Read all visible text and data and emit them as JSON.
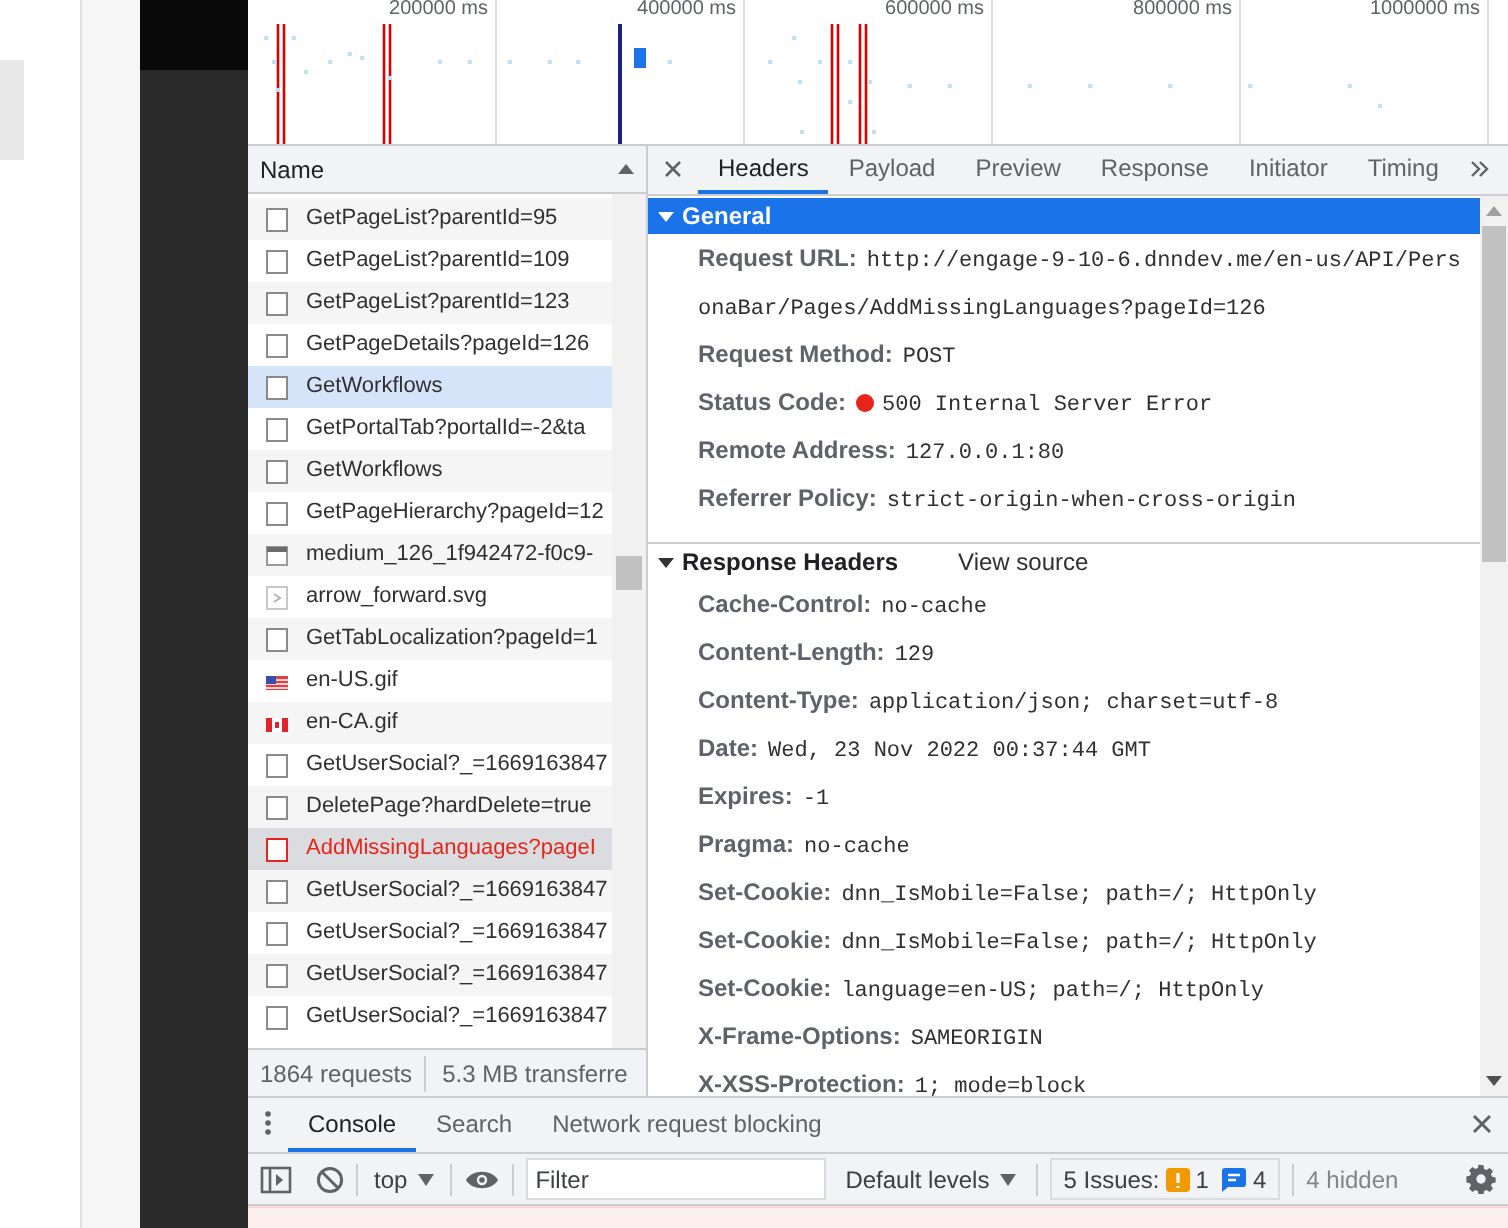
{
  "timeline": {
    "ticks": [
      "200000 ms",
      "400000 ms",
      "600000 ms",
      "800000 ms",
      "1000000 ms"
    ]
  },
  "requests": {
    "column": "Name",
    "rows": [
      {
        "name": "GetPageList?parentId=95",
        "kind": "document",
        "selected": false,
        "hovered": false,
        "error": false
      },
      {
        "name": "GetPageList?parentId=109",
        "kind": "document",
        "selected": false,
        "hovered": false,
        "error": false
      },
      {
        "name": "GetPageList?parentId=123",
        "kind": "document",
        "selected": false,
        "hovered": false,
        "error": false
      },
      {
        "name": "GetPageDetails?pageId=126",
        "kind": "document",
        "selected": false,
        "hovered": false,
        "error": false
      },
      {
        "name": "GetWorkflows",
        "kind": "document",
        "selected": false,
        "hovered": true,
        "error": false
      },
      {
        "name": "GetPortalTab?portalId=-2&ta",
        "kind": "document",
        "selected": false,
        "hovered": false,
        "error": false
      },
      {
        "name": "GetWorkflows",
        "kind": "document",
        "selected": false,
        "hovered": false,
        "error": false
      },
      {
        "name": "GetPageHierarchy?pageId=12",
        "kind": "document",
        "selected": false,
        "hovered": false,
        "error": false
      },
      {
        "name": "medium_126_1f942472-f0c9-",
        "kind": "image",
        "selected": false,
        "hovered": false,
        "error": false
      },
      {
        "name": "arrow_forward.svg",
        "kind": "svg",
        "selected": false,
        "hovered": false,
        "error": false
      },
      {
        "name": "GetTabLocalization?pageId=1",
        "kind": "document",
        "selected": false,
        "hovered": false,
        "error": false
      },
      {
        "name": "en-US.gif",
        "kind": "flag-us",
        "selected": false,
        "hovered": false,
        "error": false
      },
      {
        "name": "en-CA.gif",
        "kind": "flag-ca",
        "selected": false,
        "hovered": false,
        "error": false
      },
      {
        "name": "GetUserSocial?_=1669163847",
        "kind": "document",
        "selected": false,
        "hovered": false,
        "error": false
      },
      {
        "name": "DeletePage?hardDelete=true",
        "kind": "document",
        "selected": false,
        "hovered": false,
        "error": false
      },
      {
        "name": "AddMissingLanguages?pageI",
        "kind": "document",
        "selected": true,
        "hovered": false,
        "error": true
      },
      {
        "name": "GetUserSocial?_=1669163847",
        "kind": "document",
        "selected": false,
        "hovered": false,
        "error": false
      },
      {
        "name": "GetUserSocial?_=1669163847",
        "kind": "document",
        "selected": false,
        "hovered": false,
        "error": false
      },
      {
        "name": "GetUserSocial?_=1669163847",
        "kind": "document",
        "selected": false,
        "hovered": false,
        "error": false
      },
      {
        "name": "GetUserSocial?_=1669163847",
        "kind": "document",
        "selected": false,
        "hovered": false,
        "error": false
      }
    ],
    "summary": [
      "1864 requests",
      "5.3 MB transferre"
    ]
  },
  "details": {
    "tabs": [
      {
        "label": "Headers",
        "selected": true
      },
      {
        "label": "Payload",
        "selected": false
      },
      {
        "label": "Preview",
        "selected": false
      },
      {
        "label": "Response",
        "selected": false
      },
      {
        "label": "Initiator",
        "selected": false
      },
      {
        "label": "Timing",
        "selected": false
      }
    ],
    "sections": [
      {
        "title": "General",
        "expanded": true,
        "highlighted": true,
        "fields": [
          {
            "label": "Request URL:",
            "value": "http://engage-9-10-6.dnndev.me/en-us/API/PersonaBar/Pages/AddMissingLanguages?pageId=126"
          },
          {
            "label": "Request Method:",
            "value": "POST"
          },
          {
            "label": "Status Code:",
            "value": "500 Internal Server Error",
            "color": "#e8251b"
          },
          {
            "label": "Remote Address:",
            "value": "127.0.0.1:80"
          },
          {
            "label": "Referrer Policy:",
            "value": "strict-origin-when-cross-origin"
          }
        ]
      },
      {
        "title": "Response Headers",
        "expanded": true,
        "highlighted": false,
        "link": "View source",
        "fields": [
          {
            "label": "Cache-Control:",
            "value": "no-cache"
          },
          {
            "label": "Content-Length:",
            "value": "129"
          },
          {
            "label": "Content-Type:",
            "value": "application/json; charset=utf-8"
          },
          {
            "label": "Date:",
            "value": "Wed, 23 Nov 2022 00:37:44 GMT"
          },
          {
            "label": "Expires:",
            "value": "-1"
          },
          {
            "label": "Pragma:",
            "value": "no-cache"
          },
          {
            "label": "Set-Cookie:",
            "value": "dnn_IsMobile=False; path=/; HttpOnly"
          },
          {
            "label": "Set-Cookie:",
            "value": "dnn_IsMobile=False; path=/; HttpOnly"
          },
          {
            "label": "Set-Cookie:",
            "value": "language=en-US; path=/; HttpOnly"
          },
          {
            "label": "X-Frame-Options:",
            "value": "SAMEORIGIN"
          },
          {
            "label": "X-XSS-Protection:",
            "value": "1; mode=block"
          }
        ]
      }
    ]
  },
  "drawer": {
    "tabs": [
      {
        "label": "Console",
        "selected": true
      },
      {
        "label": "Search",
        "selected": false
      },
      {
        "label": "Network request blocking",
        "selected": false
      }
    ],
    "context": "top",
    "filter_placeholder": "Filter",
    "levels": "Default levels",
    "issues": {
      "label": "5 Issues:",
      "warnings": "1",
      "infos": "4"
    },
    "hidden": "4 hidden"
  }
}
